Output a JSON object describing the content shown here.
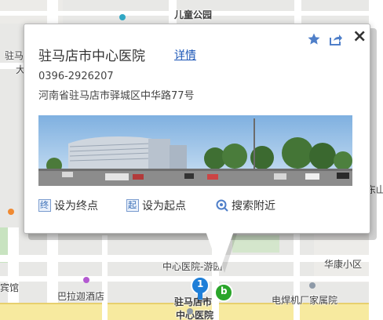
{
  "map": {
    "labels": {
      "children_park": "儿童公园",
      "zhuma_left_1": "驻马",
      "zhuma_left_2": "大",
      "dongshan": "东山",
      "hospital_park": "中心医院-游园",
      "huakang": "华康小区",
      "guan": "宾馆",
      "bashang_hotel": "巴拉迦酒店",
      "hospital_name_1": "驻马店市",
      "hospital_name_2": "中心医院",
      "welding_factory": "电焊机厂家属院"
    },
    "markers": {
      "marker_1": "1",
      "marker_b": "b"
    },
    "colors": {
      "marker_blue": "#1f7fd8",
      "marker_green": "#2aa52a",
      "link": "#1a55b6"
    }
  },
  "popup": {
    "title": "驻马店市中心医院",
    "detail_link": "详情",
    "phone": "0396-2926207",
    "address": "河南省驻马店市驿城区中华路77号",
    "toolbar_icons": [
      "star-icon",
      "share-icon",
      "close-icon"
    ],
    "close_label": "×",
    "actions": [
      {
        "icon_char": "终",
        "label": "设为终点"
      },
      {
        "icon_char": "起",
        "label": "设为起点"
      },
      {
        "icon_char": "",
        "label": "搜索附近"
      }
    ]
  }
}
